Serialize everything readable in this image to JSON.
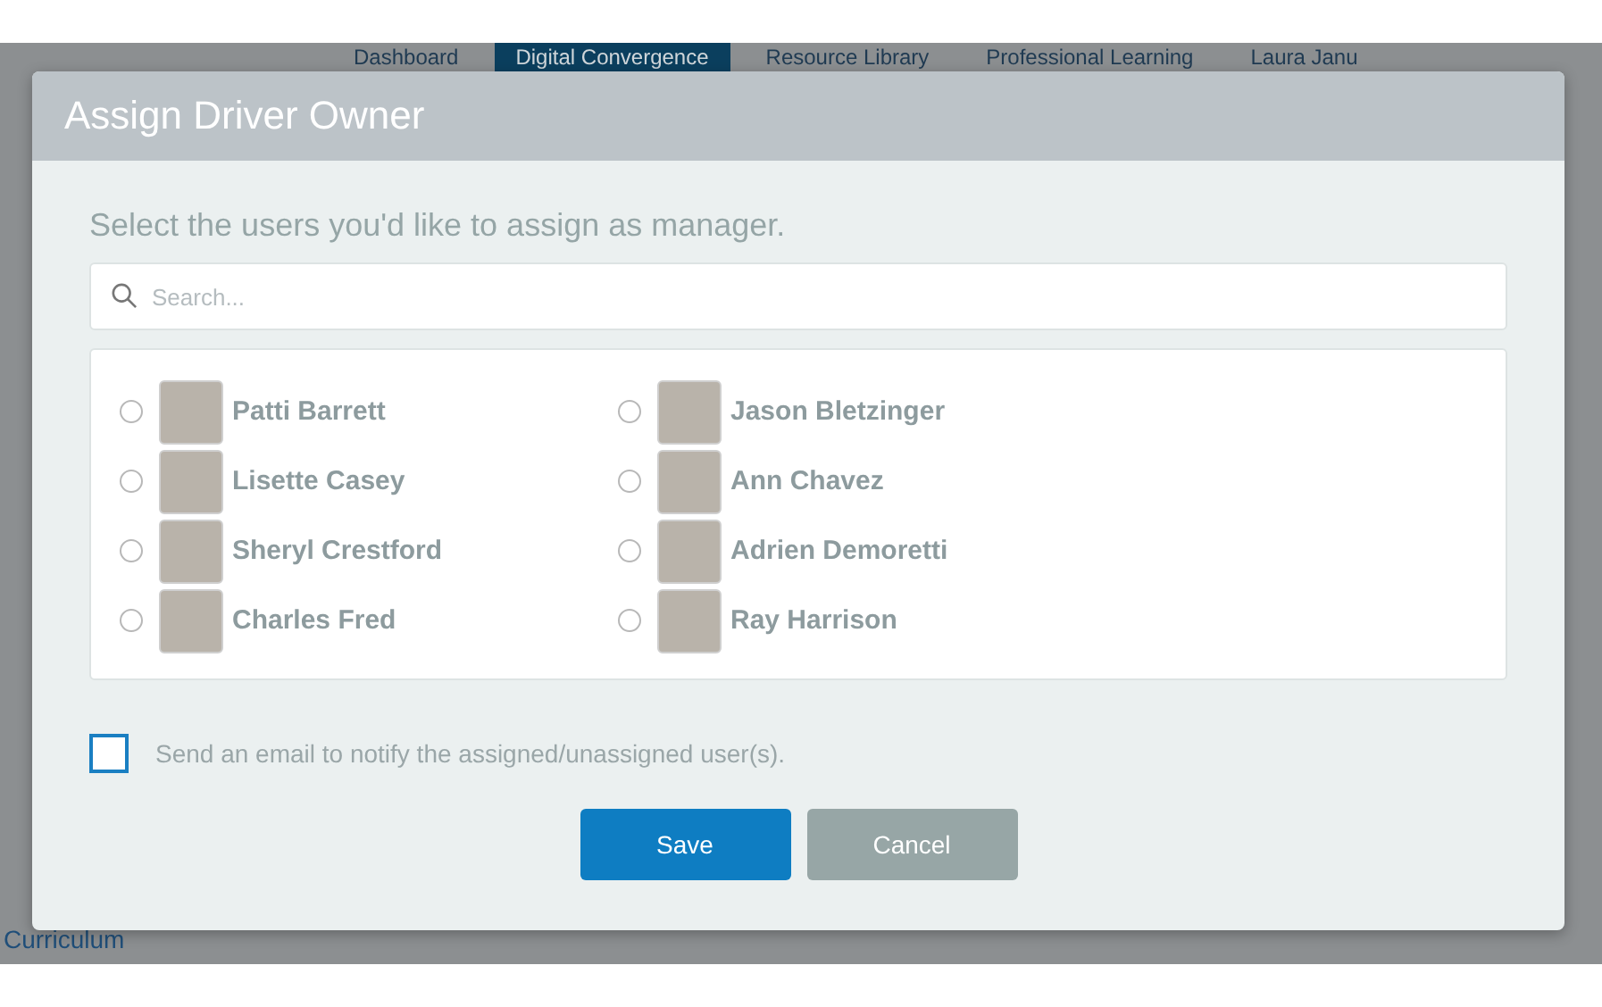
{
  "nav": {
    "items": [
      {
        "label": "Dashboard",
        "selected": false
      },
      {
        "label": "Digital Convergence",
        "selected": true
      },
      {
        "label": "Resource Library",
        "selected": false
      },
      {
        "label": "Professional Learning",
        "selected": false
      },
      {
        "label": "Laura Janu",
        "selected": false
      }
    ]
  },
  "background": {
    "section_label": "Curriculum"
  },
  "dialog": {
    "title": "Assign Driver Owner",
    "prompt": "Select the users you'd like to assign as manager.",
    "search": {
      "placeholder": "Search..."
    },
    "users": [
      {
        "name": "Patti Barrett",
        "selected": false
      },
      {
        "name": "Jason Bletzinger",
        "selected": false
      },
      {
        "name": "Lisette Casey",
        "selected": false
      },
      {
        "name": "Ann Chavez",
        "selected": false
      },
      {
        "name": "Sheryl Crestford",
        "selected": false
      },
      {
        "name": "Adrien Demoretti",
        "selected": false
      },
      {
        "name": "Charles Fred",
        "selected": false
      },
      {
        "name": "Ray Harrison",
        "selected": false
      }
    ],
    "notify": {
      "label": "Send an email to notify the assigned/unassigned user(s).",
      "checked": false
    },
    "buttons": [
      {
        "label": "Save",
        "kind": "primary"
      },
      {
        "label": "Cancel",
        "kind": "secondary"
      }
    ]
  }
}
